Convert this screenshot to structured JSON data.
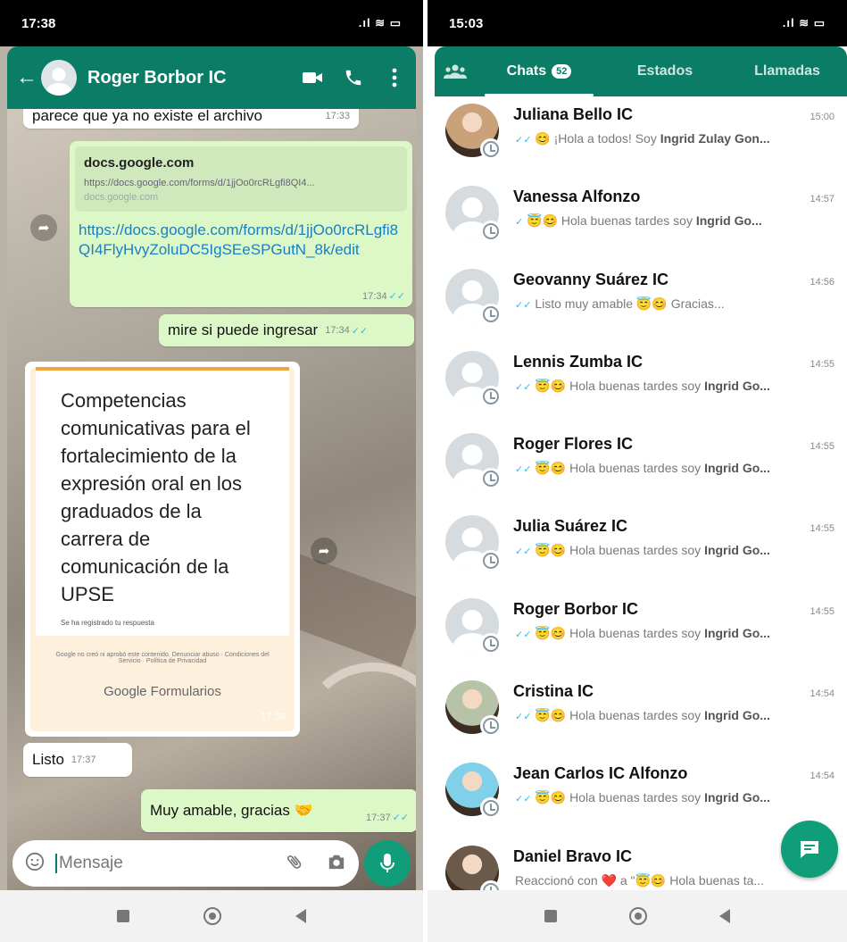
{
  "left": {
    "status_time": "17:38",
    "status_icons": ".ıl ≋ ▭",
    "header": {
      "back": "←",
      "contact_name": "Roger Borbor IC"
    },
    "messages": {
      "m1": {
        "text": "parece que ya no existe el archivo",
        "time": "17:33"
      },
      "m2": {
        "preview_title": "docs.google.com",
        "preview_url": "https://docs.google.com/forms/d/1jjOo0rcRLgfi8QI4...",
        "preview_domain": "docs.google.com",
        "link": "https://docs.google.com/forms/d/1jjOo0rcRLgfi8QI4FlyHvyZoluDC5IgSEeSPGutN_8k/edit",
        "time": "17:34"
      },
      "m3": {
        "text": "mire si puede ingresar",
        "time": "17:34"
      },
      "m4": {
        "form_title": "Competencias comunicativas para el fortalecimiento de la expresión oral en los graduados de la carrera de comunicación de la UPSE",
        "form_subtitle": "Se ha registrado tu respuesta",
        "form_footer": "Google no creó ni aprobó este contenido. Denunciar abuso · Condiciones del Servicio · Política de Privacidad",
        "brand_google": "Google",
        "brand_forms": "Formularios",
        "time": "17:36"
      },
      "m5": {
        "text": "Listo",
        "time": "17:37"
      },
      "m6": {
        "text": "Muy amable, gracias",
        "emoji": "🤝",
        "time": "17:37"
      }
    },
    "input": {
      "placeholder": "Mensaje"
    }
  },
  "right": {
    "status_time": "15:03",
    "status_icons": ".ıl ≋ ▭",
    "tabs": {
      "community_icon": "community-icon",
      "chats": "Chats",
      "chats_badge": "52",
      "status": "Estados",
      "calls": "Llamadas"
    },
    "chats": [
      {
        "name": "Juliana Bello IC",
        "time": "15:00",
        "preview": "😊 ¡Hola a todos! Soy ",
        "bold": "Ingrid Zulay Gon...",
        "tick": "✓✓",
        "avatar": "photo",
        "color": "#caa27a"
      },
      {
        "name": "Vanessa Alfonzo",
        "time": "14:57",
        "preview": "😇😊 Hola buenas tardes soy ",
        "bold": "Ingrid Go...",
        "tick": "✓",
        "avatar": "placeholder"
      },
      {
        "name": "Geovanny Suárez IC",
        "time": "14:56",
        "preview": "Listo muy amable 😇😊 Gracias...",
        "bold": "",
        "tick": "✓✓",
        "avatar": "placeholder"
      },
      {
        "name": "Lennis Zumba IC",
        "time": "14:55",
        "preview": "😇😊 Hola buenas tardes soy ",
        "bold": "Ingrid Go...",
        "tick": "✓✓",
        "avatar": "placeholder"
      },
      {
        "name": "Roger Flores IC",
        "time": "14:55",
        "preview": "😇😊 Hola buenas tardes soy ",
        "bold": "Ingrid Go...",
        "tick": "✓✓",
        "avatar": "placeholder"
      },
      {
        "name": "Julia Suárez IC",
        "time": "14:55",
        "preview": "😇😊 Hola buenas tardes soy ",
        "bold": "Ingrid Go...",
        "tick": "✓✓",
        "avatar": "placeholder"
      },
      {
        "name": "Roger Borbor IC",
        "time": "14:55",
        "preview": "😇😊 Hola buenas tardes soy ",
        "bold": "Ingrid Go...",
        "tick": "✓✓",
        "avatar": "placeholder"
      },
      {
        "name": "Cristina IC",
        "time": "14:54",
        "preview": "😇😊 Hola buenas tardes soy ",
        "bold": "Ingrid Go...",
        "tick": "✓✓",
        "avatar": "photo",
        "color": "#b7c3a8"
      },
      {
        "name": "Jean Carlos IC Alfonzo",
        "time": "14:54",
        "preview": "😇😊 Hola buenas tardes soy ",
        "bold": "Ingrid Go...",
        "tick": "✓✓",
        "avatar": "photo",
        "color": "#7fd0e8"
      },
      {
        "name": "Daniel Bravo IC",
        "time": "",
        "preview": "Reaccionó con ❤️ a \"😇😊 Hola buenas ta...",
        "bold": "",
        "tick": "",
        "avatar": "photo",
        "color": "#6b5a4a"
      }
    ]
  }
}
